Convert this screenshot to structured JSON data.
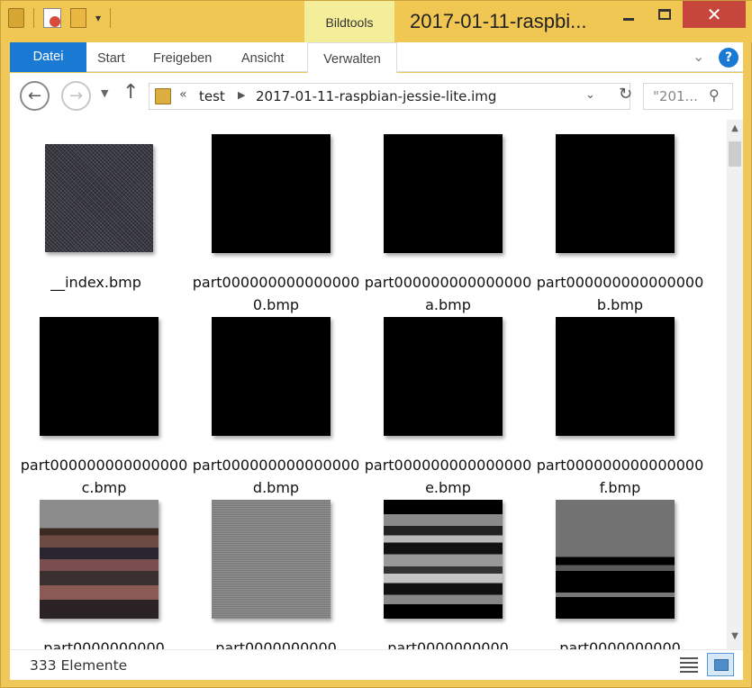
{
  "title_bar": {
    "contextual_tab": "Bildtools",
    "title": "2017-01-11-raspbi..."
  },
  "window_controls": {
    "minimize": "",
    "maximize": "",
    "close": "✕"
  },
  "ribbon": {
    "tabs": [
      "Datei",
      "Start",
      "Freigeben",
      "Ansicht",
      "Verwalten"
    ],
    "help": "?"
  },
  "address": {
    "overflow_chevron": "«",
    "segments": [
      "test",
      "2017-01-11-raspbian-jessie-lite.img"
    ]
  },
  "search": {
    "placeholder": "\"201..."
  },
  "files": [
    {
      "name": "__index.bmp",
      "thumbnail": "noise-index"
    },
    {
      "name": "part0000000000000000.bmp",
      "thumbnail": "black"
    },
    {
      "name": "part000000000000000a.bmp",
      "thumbnail": "black"
    },
    {
      "name": "part000000000000000b.bmp",
      "thumbnail": "black"
    },
    {
      "name": "part000000000000000c.bmp",
      "thumbnail": "black"
    },
    {
      "name": "part000000000000000d.bmp",
      "thumbnail": "black"
    },
    {
      "name": "part000000000000000e.bmp",
      "thumbnail": "black"
    },
    {
      "name": "part000000000000000f.bmp",
      "thumbnail": "black"
    },
    {
      "name": "part0000000000",
      "thumbnail": "noise-color"
    },
    {
      "name": "part0000000000",
      "thumbnail": "noise-gray"
    },
    {
      "name": "part0000000000",
      "thumbnail": "noise-bw"
    },
    {
      "name": "part0000000000",
      "thumbnail": "noise-mixed"
    }
  ],
  "status": {
    "count": "333 Elemente"
  },
  "colors": {
    "title_bar": "#f1c753",
    "accent": "#1a79d2",
    "close": "#c7463b"
  }
}
